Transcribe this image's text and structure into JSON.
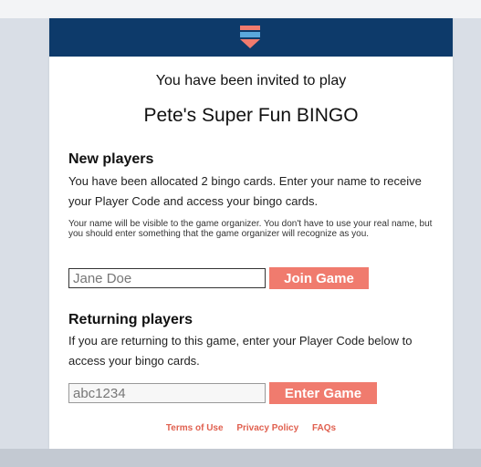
{
  "header": {
    "logo_icon": "flag-shield-icon",
    "bar_color": "#0d3a6a"
  },
  "invite": {
    "line": "You have been invited to play",
    "game_name": "Pete's Super Fun BINGO"
  },
  "new_players": {
    "heading": "New players",
    "description": "You have been allocated 2 bingo cards. Enter your name to receive your Player Code and access your bingo cards.",
    "note": "Your name will be visible to the game organizer. You don't have to use your real name, but you should enter something that the game organizer will recognize as you.",
    "name_placeholder": "Jane Doe",
    "name_value": "",
    "join_label": "Join Game"
  },
  "returning_players": {
    "heading": "Returning players",
    "description": "If you are returning to this game, enter your Player Code below to access your bingo cards.",
    "code_value": "abc1234",
    "enter_label": "Enter Game"
  },
  "footer": {
    "links": [
      "Terms of Use",
      "Privacy Policy",
      "FAQs"
    ]
  },
  "colors": {
    "accent": "#f07b6e",
    "link": "#e0604f"
  }
}
